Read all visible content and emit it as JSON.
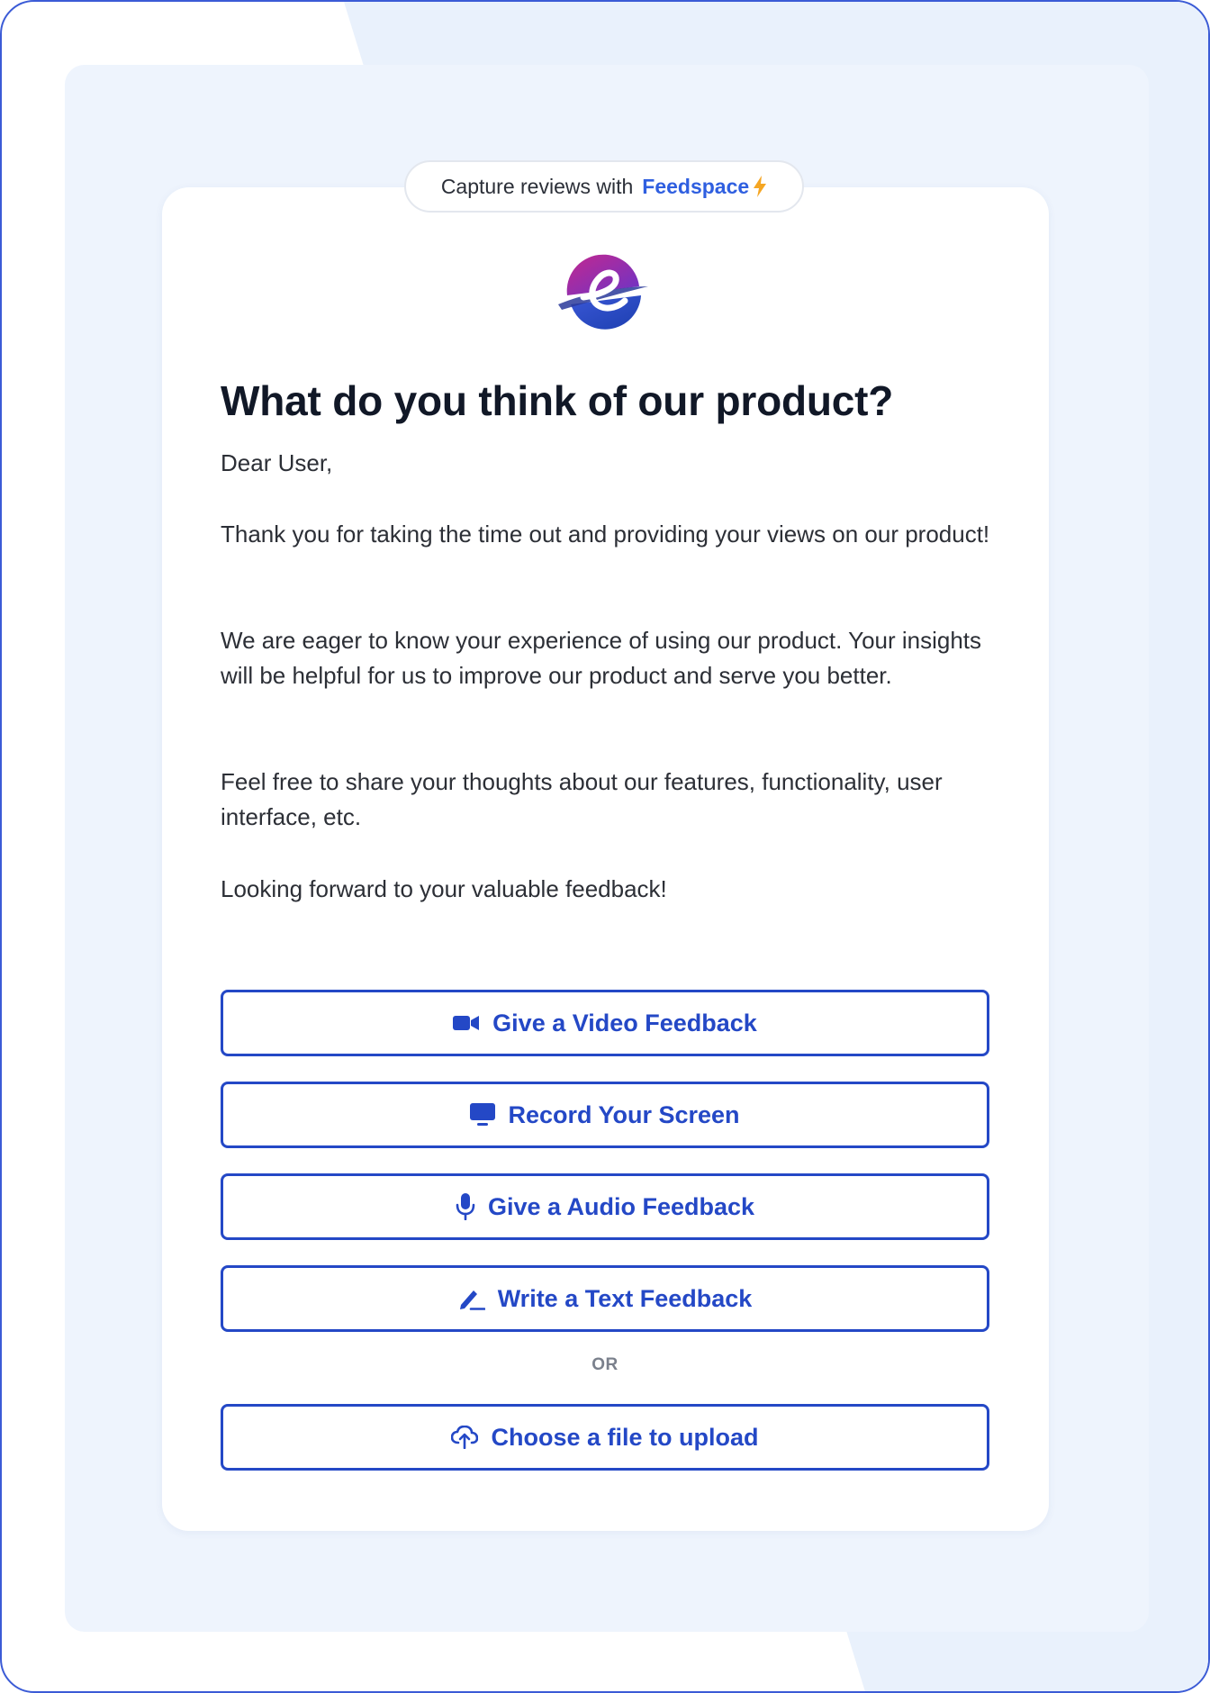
{
  "banner": {
    "prefix": "Capture reviews with",
    "brand": "Feedspace",
    "bolt_icon": "lightning-bolt-icon"
  },
  "logo": {
    "icon": "planet-e-logo"
  },
  "form": {
    "title": "What do you think of our product?",
    "greeting": "Dear User,",
    "paragraphs": [
      "Thank you for taking the time out and providing your views on our product!",
      "We are eager to know your experience of using our product. Your insights will be helpful for us to improve our product and serve you better.",
      "Feel free to share your thoughts about our features, functionality, user interface, etc.",
      "Looking forward to your valuable feedback!"
    ]
  },
  "actions": {
    "video": {
      "label": "Give a Video Feedback",
      "icon": "video-camera-icon"
    },
    "screen": {
      "label": "Record Your Screen",
      "icon": "monitor-icon"
    },
    "audio": {
      "label": "Give a Audio Feedback",
      "icon": "microphone-icon"
    },
    "text": {
      "label": "Write a Text Feedback",
      "icon": "pen-icon"
    },
    "separator": "OR",
    "upload": {
      "label": "Choose a file to upload",
      "icon": "cloud-upload-icon"
    }
  },
  "colors": {
    "accent": "#2448c6",
    "brand": "#2f5fe0",
    "bolt": "#f5a623",
    "panel_bg": "#eef4fd",
    "frame_border": "#3b5bd6"
  }
}
